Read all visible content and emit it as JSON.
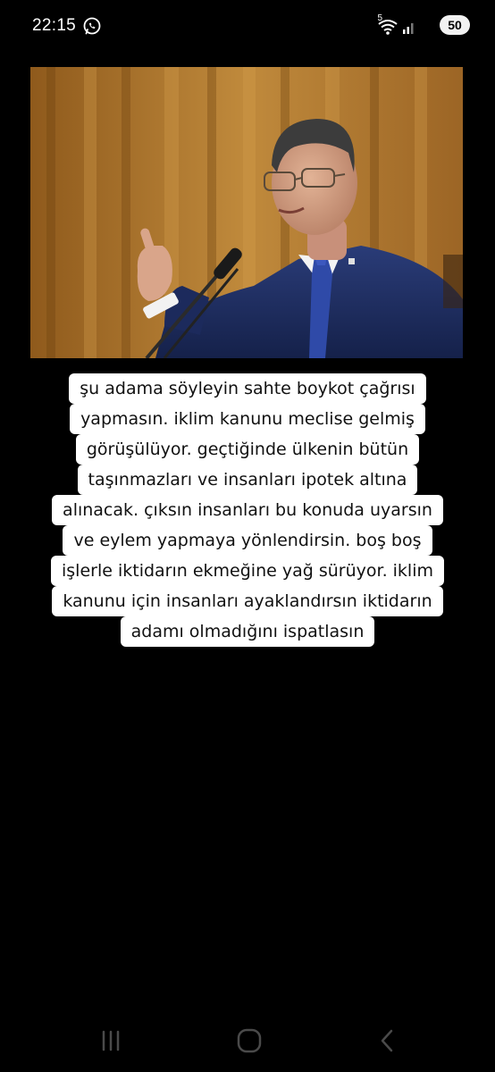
{
  "status_bar": {
    "time": "22:15",
    "battery": "50",
    "network_badge": "5"
  },
  "post": {
    "caption_lines": [
      "şu adama söyleyin sahte boykot çağrısı",
      "yapmasın. iklim kanunu meclise gelmiş",
      "görüşülüyor. geçtiğinde ülkenin bütün",
      "taşınmazları ve insanları ipotek altına",
      "alınacak. çıksın insanları bu konuda uyarsın",
      "ve eylem yapmaya yönlendirsin. boş boş",
      "işlerle  iktidarın ekmeğine yağ sürüyor. iklim",
      "kanunu için insanları ayaklandırsın iktidarın",
      "adamı olmadığını ispatlasın"
    ]
  },
  "icons": {
    "whatsapp": "whatsapp-icon",
    "wifi": "wifi-icon",
    "signal": "signal-icon",
    "recent_apps": "recent-apps-icon",
    "home": "home-icon",
    "back": "back-icon"
  },
  "colors": {
    "background": "#000000",
    "caption_bg": "#ffffff",
    "caption_text": "#111111",
    "curtain": "#b27a2c",
    "suit": "#1f2f63",
    "nav_icon": "#4a4a4a"
  }
}
